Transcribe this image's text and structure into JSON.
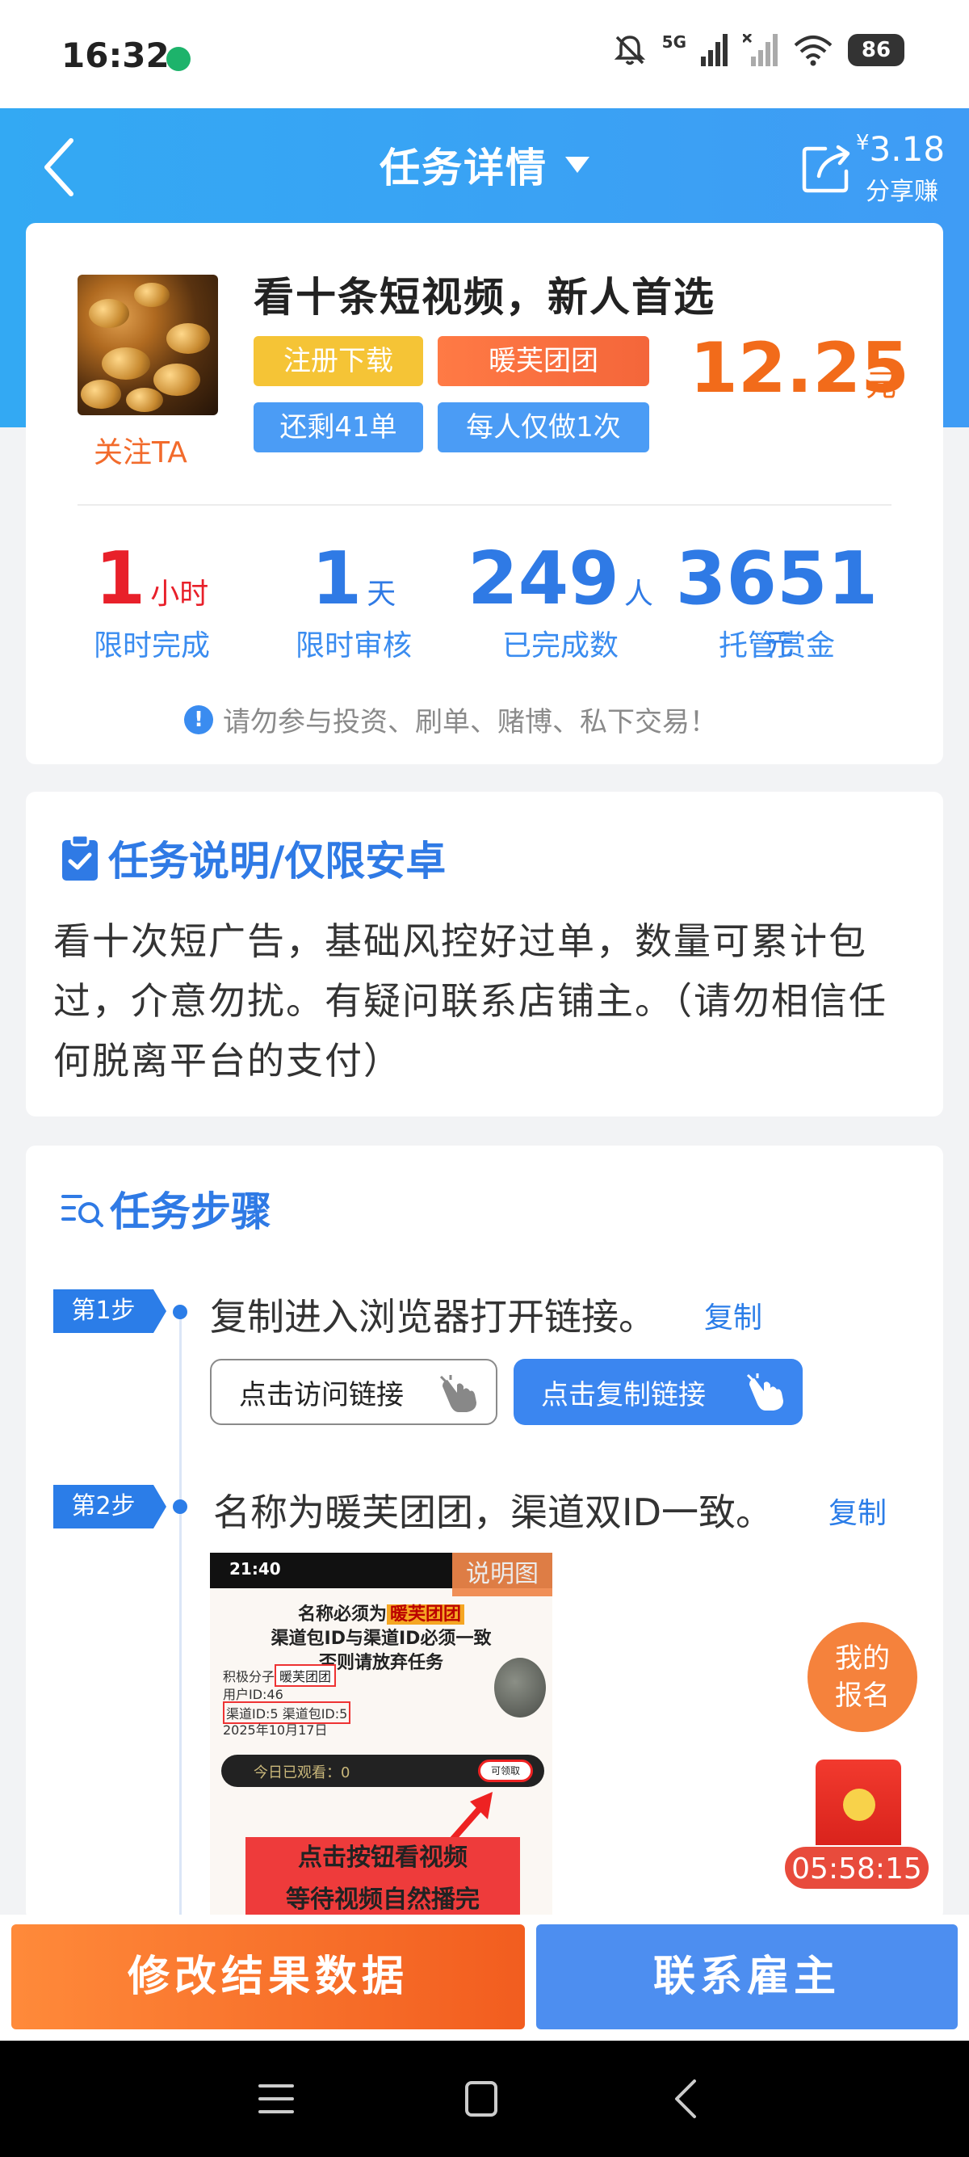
{
  "status_bar": {
    "time": "16:32",
    "network_label": "5G",
    "battery": "86",
    "icons": [
      "mute-bell-icon",
      "signal-5g-icon",
      "signal-no-sim-icon",
      "wifi-icon",
      "battery-icon"
    ]
  },
  "header": {
    "title": "任务详情",
    "share_currency": "¥",
    "share_amount": "3.18",
    "share_label": "分享赚"
  },
  "task": {
    "title": "看十条短视频，新人首选",
    "follow_label": "关注TA",
    "tags": [
      "注册下载",
      "暖芙团团",
      "还剩41单",
      "每人仅做1次"
    ],
    "price": "12.25",
    "price_unit": "元"
  },
  "stats": [
    {
      "value": "1",
      "unit": "小时",
      "label": "限时完成",
      "color": "#e8202a"
    },
    {
      "value": "1",
      "unit": "天",
      "label": "限时审核",
      "color": "#2f7ae5"
    },
    {
      "value": "249",
      "unit": "人",
      "label": "已完成数",
      "color": "#2f7ae5"
    },
    {
      "value": "3651",
      "unit": "元",
      "label": "托管赏金",
      "color": "#2f7ae5"
    }
  ],
  "warning": "请勿参与投资、刷单、赌博、私下交易！",
  "description": {
    "title": "任务说明/仅限安卓",
    "text": "看十次短广告，基础风控好过单，数量可累计包过，介意勿扰。有疑问联系店铺主。（请勿相信任何脱离平台的支付）"
  },
  "steps": {
    "title": "任务步骤",
    "items": [
      {
        "badge": "第1步",
        "text": "复制进入浏览器打开链接。",
        "copy": "复制"
      },
      {
        "badge": "第2步",
        "text": "名称为暖芙团团，渠道双ID一致。",
        "copy": "复制"
      }
    ],
    "visit_link_button": "点击访问链接",
    "copy_link_button": "点击复制链接"
  },
  "explain_image": {
    "badge": "说明图",
    "time": "21:40",
    "line1_prefix": "名称必须为",
    "line1_highlight": "暖芙团团",
    "line2": "渠道包ID与渠道ID必须一致",
    "line3": "否则请放弃任务",
    "user_name": "积极分子",
    "name_box": "暖芙团团",
    "user_id": "用户ID:46",
    "channel_ids": "渠道ID:5  渠道包ID:5",
    "date": "2025年10月17日",
    "watched_today": "今日已观看：0",
    "claim": "可领取",
    "red_line1": "点击按钮看视频",
    "red_line2": "等待视频自然播完"
  },
  "floating": {
    "signup_line1": "我的",
    "signup_line2": "报名",
    "countdown": "05:58:15"
  },
  "actions": {
    "modify": "修改结果数据",
    "contact": "联系雇主"
  }
}
